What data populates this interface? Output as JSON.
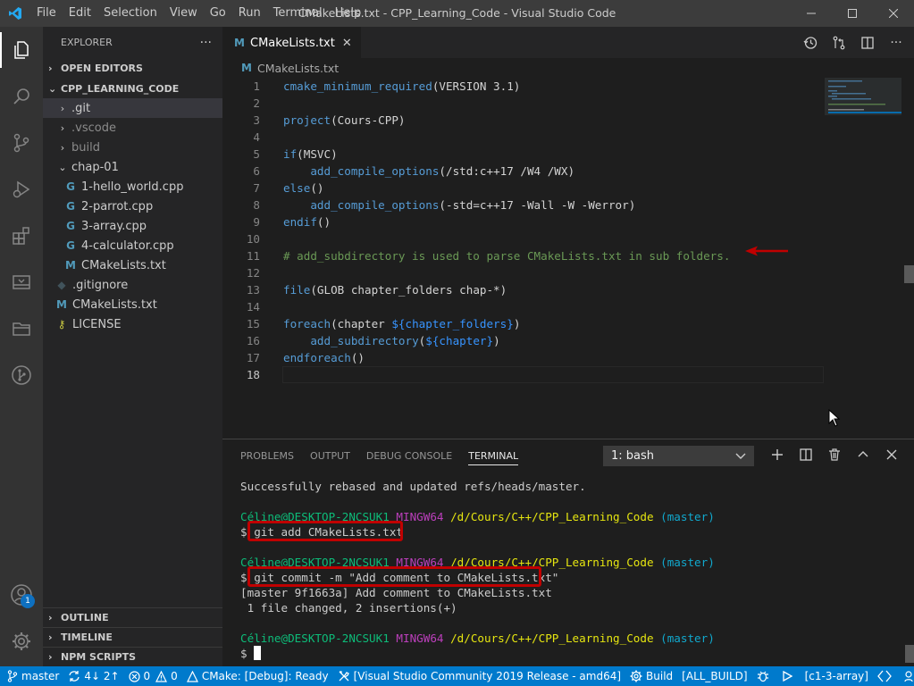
{
  "app": {
    "title": "CMakeLists.txt - CPP_Learning_Code - Visual Studio Code",
    "menu": [
      "File",
      "Edit",
      "Selection",
      "View",
      "Go",
      "Run",
      "Terminal",
      "Help"
    ],
    "accent": "#007acc"
  },
  "activity": {
    "account_badge": "1"
  },
  "sidebar": {
    "header": "EXPLORER",
    "more": "···",
    "open_editors": "OPEN EDITORS",
    "project": "CPP_LEARNING_CODE",
    "tree": [
      {
        "label": ".git",
        "type": "folder"
      },
      {
        "label": ".vscode",
        "type": "folder"
      },
      {
        "label": "build",
        "type": "folder"
      },
      {
        "label": "chap-01",
        "type": "folder-open"
      },
      {
        "label": "1-hello_world.cpp",
        "type": "cpp"
      },
      {
        "label": "2-parrot.cpp",
        "type": "cpp"
      },
      {
        "label": "3-array.cpp",
        "type": "cpp"
      },
      {
        "label": "4-calculator.cpp",
        "type": "cpp"
      },
      {
        "label": "CMakeLists.txt",
        "type": "cmake"
      },
      {
        "label": ".gitignore",
        "type": "git"
      },
      {
        "label": "CMakeLists.txt",
        "type": "cmake"
      },
      {
        "label": "LICENSE",
        "type": "license"
      }
    ],
    "outline": "OUTLINE",
    "timeline": "TIMELINE",
    "npm": "NPM SCRIPTS"
  },
  "editor": {
    "tab": "CMakeLists.txt",
    "tab_close": "✕",
    "breadcrumb": "CMakeLists.txt",
    "lines": [
      {
        "n": "1",
        "parts": [
          [
            "fn2",
            "cmake_minimum_required"
          ],
          [
            "tx",
            "(VERSION 3.1)"
          ]
        ]
      },
      {
        "n": "2",
        "parts": []
      },
      {
        "n": "3",
        "parts": [
          [
            "fn2",
            "project"
          ],
          [
            "tx",
            "(Cours-CPP)"
          ]
        ]
      },
      {
        "n": "4",
        "parts": []
      },
      {
        "n": "5",
        "parts": [
          [
            "kw",
            "if"
          ],
          [
            "tx",
            "(MSVC)"
          ]
        ]
      },
      {
        "n": "6",
        "parts": [
          [
            "tx",
            "    "
          ],
          [
            "fn2",
            "add_compile_options"
          ],
          [
            "tx",
            "(/std:c++17 /W4 /WX)"
          ]
        ]
      },
      {
        "n": "7",
        "parts": [
          [
            "kw",
            "else"
          ],
          [
            "tx",
            "()"
          ]
        ]
      },
      {
        "n": "8",
        "parts": [
          [
            "tx",
            "    "
          ],
          [
            "fn2",
            "add_compile_options"
          ],
          [
            "tx",
            "(-std=c++17 -Wall -W -Werror)"
          ]
        ]
      },
      {
        "n": "9",
        "parts": [
          [
            "kw",
            "endif"
          ],
          [
            "tx",
            "()"
          ]
        ]
      },
      {
        "n": "10",
        "parts": []
      },
      {
        "n": "11",
        "parts": [
          [
            "cm",
            "# add_subdirectory is used to parse CMakeLists.txt in sub folders."
          ]
        ]
      },
      {
        "n": "12",
        "parts": []
      },
      {
        "n": "13",
        "parts": [
          [
            "fn2",
            "file"
          ],
          [
            "tx",
            "(GLOB chapter_folders chap-*)"
          ]
        ]
      },
      {
        "n": "14",
        "parts": []
      },
      {
        "n": "15",
        "parts": [
          [
            "kw",
            "foreach"
          ],
          [
            "tx",
            "(chapter "
          ],
          [
            "pl",
            "${chapter_folders}"
          ],
          [
            "tx",
            ")"
          ]
        ]
      },
      {
        "n": "16",
        "parts": [
          [
            "tx",
            "    "
          ],
          [
            "fn2",
            "add_subdirectory"
          ],
          [
            "tx",
            "("
          ],
          [
            "pl",
            "${chapter}"
          ],
          [
            "tx",
            ")"
          ]
        ]
      },
      {
        "n": "17",
        "parts": [
          [
            "kw",
            "endforeach"
          ],
          [
            "tx",
            "()"
          ]
        ]
      },
      {
        "n": "18",
        "parts": []
      }
    ]
  },
  "panel": {
    "tabs": [
      "PROBLEMS",
      "OUTPUT",
      "DEBUG CONSOLE",
      "TERMINAL"
    ],
    "active_tab": "TERMINAL",
    "terminal_select": "1: bash",
    "terminal": {
      "rebased": "Successfully rebased and updated refs/heads/master.",
      "user": "Céline@DESKTOP-2NCSUK1",
      "mingw": "MINGW64",
      "path": "/d/Cours/C++/CPP_Learning_Code",
      "branch": "(master)",
      "prompt": "$",
      "cmd1": "git add CMakeLists.txt",
      "cmd2": "git commit -m \"Add comment to CMakeLists.txt\"",
      "out1": "[master 9f1663a] Add comment to CMakeLists.txt",
      "out2": " 1 file changed, 2 insertions(+)"
    }
  },
  "status": {
    "branch": "master",
    "sync": "4↓ 2↑",
    "errors": "0",
    "warnings": "0",
    "cmake": "CMake: [Debug]: Ready",
    "kit": "[Visual Studio Community 2019 Release - amd64]",
    "build": "Build",
    "target": "[ALL_BUILD]",
    "launch_target": "[c1-3-array]"
  }
}
